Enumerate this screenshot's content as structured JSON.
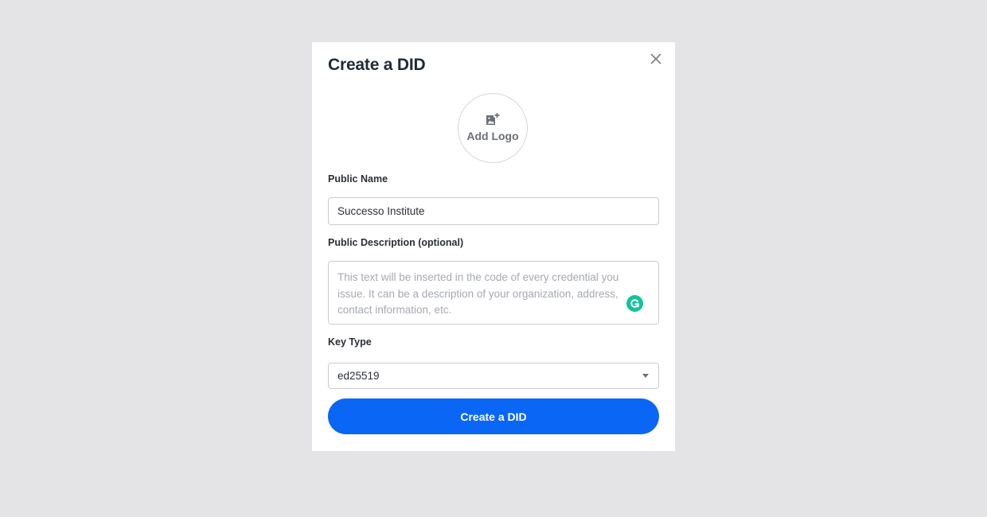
{
  "modal": {
    "title": "Create a DID",
    "close_icon": "close-icon"
  },
  "logo": {
    "icon": "add-image-icon",
    "label": "Add Logo"
  },
  "public_name": {
    "label": "Public Name",
    "value": "Successo Institute"
  },
  "description": {
    "label": "Public Description (optional)",
    "placeholder": "This text will be inserted in the code of every credential you issue. It can be a description of your organization, address, contact information, etc.",
    "value": ""
  },
  "key_type": {
    "label": "Key Type",
    "selected": "ed25519",
    "icon": "chevron-down-icon"
  },
  "submit": {
    "label": "Create a DID"
  },
  "colors": {
    "page_background": "#e4e4e6",
    "modal_background": "#ffffff",
    "primary": "#0a66f5",
    "grammarly": "#15c39a"
  }
}
